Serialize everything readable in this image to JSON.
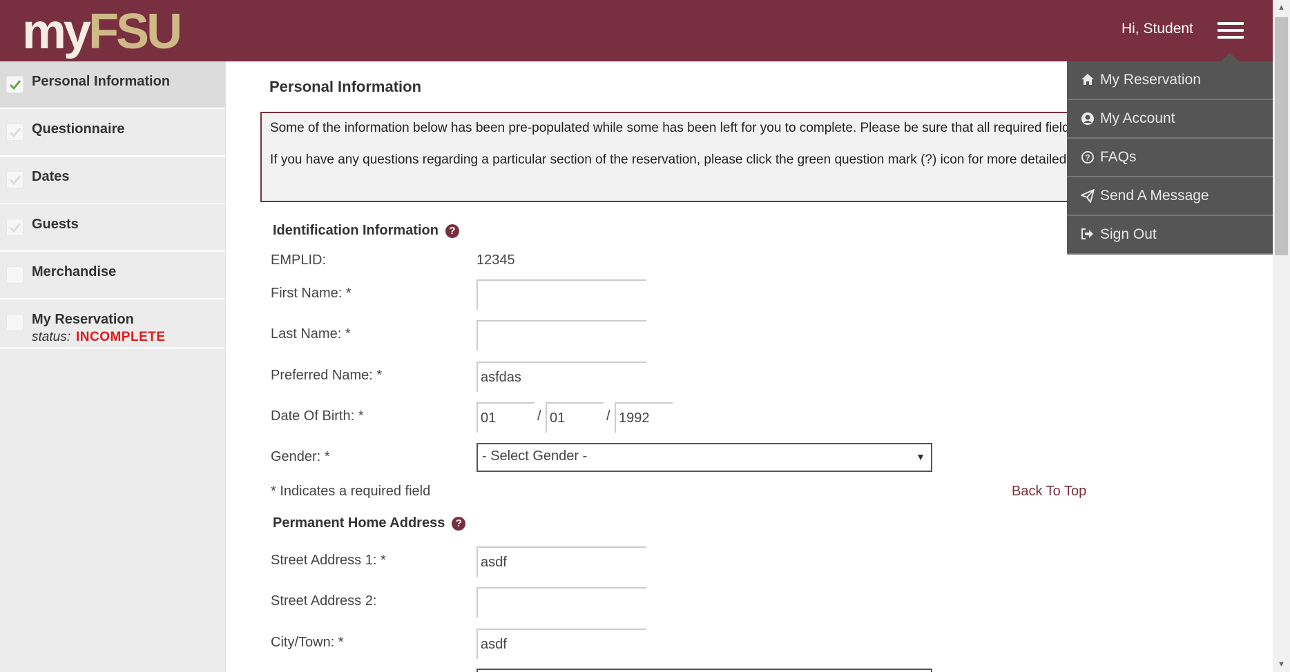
{
  "header": {
    "logo_my": "my",
    "logo_fsu": "FSU",
    "greeting": "Hi, Student"
  },
  "sidebar": {
    "items": [
      {
        "label": "Personal Information",
        "checked": true
      },
      {
        "label": "Questionnaire",
        "checked": false
      },
      {
        "label": "Dates",
        "checked": false
      },
      {
        "label": "Guests",
        "checked": false
      },
      {
        "label": "Merchandise",
        "checked": false
      },
      {
        "label": "My Reservation",
        "checked": false
      }
    ],
    "status_label": "status:",
    "status_value": "INCOMPLETE"
  },
  "main": {
    "title": "Personal Information",
    "notice_p1": "Some of the information below has been pre-populated while some has been left for you to complete. Please be sure that all required fields are completed.",
    "notice_p2": "If you have any questions regarding a particular section of the reservation, please click the green question mark (?) icon for more detailed instructions.",
    "identification": {
      "heading": "Identification Information",
      "emplid_label": "EMPLID:",
      "emplid_value": "12345",
      "first_name_label": "First Name: *",
      "first_name_value": "",
      "last_name_label": "Last Name: *",
      "last_name_value": "",
      "preferred_name_label": "Preferred Name: *",
      "preferred_name_value": "asfdas",
      "dob_label": "Date Of Birth: *",
      "dob_month": "01",
      "dob_day": "01",
      "dob_year": "1992",
      "dob_sep": "/",
      "gender_label": "Gender: *",
      "gender_value": "- Select Gender -"
    },
    "required_note": "* Indicates a required field",
    "back_to_top": "Back To Top",
    "address": {
      "heading": "Permanent Home Address",
      "street1_label": "Street Address 1: *",
      "street1_value": "asdf",
      "street2_label": "Street Address 2:",
      "street2_value": "",
      "city_label": "City/Town: *",
      "city_value": "asdf"
    }
  },
  "menu": {
    "items": [
      {
        "label": "My Reservation",
        "icon": "home-icon"
      },
      {
        "label": "My Account",
        "icon": "user-circle-icon"
      },
      {
        "label": "FAQs",
        "icon": "question-circle-icon"
      },
      {
        "label": "Send A Message",
        "icon": "paper-plane-icon"
      },
      {
        "label": "Sign Out",
        "icon": "sign-out-icon"
      }
    ]
  },
  "colors": {
    "brand": "#782f40",
    "gold": "#cfb987",
    "status": "#e01a1a",
    "menu_bg": "#555555"
  }
}
